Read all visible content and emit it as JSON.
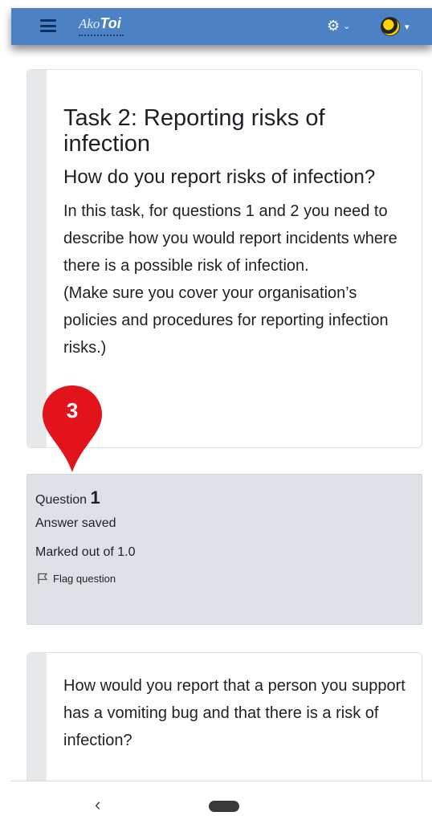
{
  "app": {
    "logo_part1": "Ako",
    "logo_part2": "Toi",
    "colors": {
      "topbar": "#4c82c3",
      "marker": "#e3131c",
      "question_box": "#dee2e6"
    }
  },
  "intro": {
    "title": "Task 2: Reporting risks of infection",
    "subtitle": "How do you report risks of infection?",
    "paragraph_1": "In this task, for questions 1 and 2 you need to describe how you would report incidents where there is a possible risk of infection.",
    "paragraph_2": "(Make sure you cover your organisation’s policies and procedures for reporting infection risks.)"
  },
  "marker": {
    "number": "3"
  },
  "question": {
    "label": "Question",
    "number": "1",
    "state": "Answer saved",
    "grade": "Marked out of 1.0",
    "flag_label": "Flag question",
    "text": "How would you report that a person you support has a vomiting bug and that there is a risk of infection?"
  },
  "icons": {
    "menu": "hamburger-icon",
    "settings": "gear-icon",
    "avatar": "user-avatar",
    "flag": "flag-icon",
    "back": "chevron-left-icon",
    "home": "home-pill"
  }
}
